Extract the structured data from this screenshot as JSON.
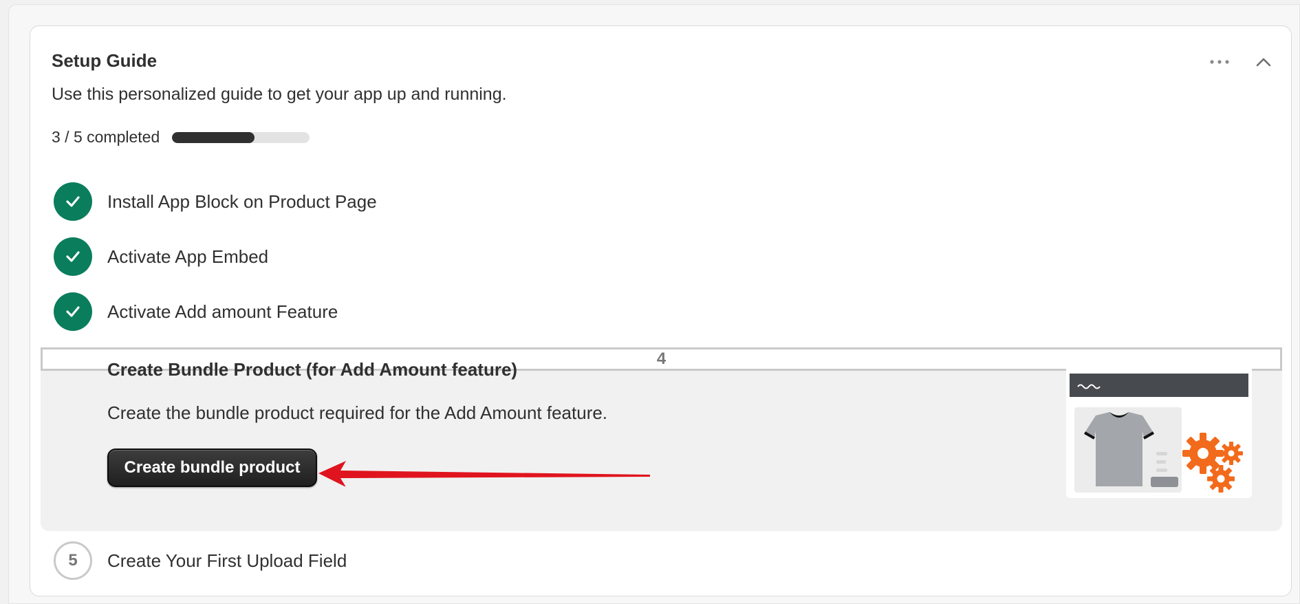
{
  "guide": {
    "title": "Setup Guide",
    "subtitle": "Use this personalized guide to get your app up and running.",
    "progress": {
      "text": "3 / 5 completed",
      "completed": 3,
      "total": 5,
      "fraction": 0.6
    },
    "actions": {
      "more_icon": "ellipsis-horizontal-icon",
      "collapse_icon": "chevron-up-icon"
    }
  },
  "steps": [
    {
      "number": "1",
      "label": "Install App Block on Product Page",
      "status": "completed"
    },
    {
      "number": "2",
      "label": "Activate App Embed",
      "status": "completed"
    },
    {
      "number": "3",
      "label": "Activate Add amount Feature",
      "status": "completed"
    },
    {
      "number": "4",
      "label": "Create Bundle Product (for Add Amount feature)",
      "status": "active",
      "description": "Create the bundle product required for the Add Amount feature.",
      "button_label": "Create bundle product"
    },
    {
      "number": "5",
      "label": "Create Your First Upload Field",
      "status": "pending"
    }
  ],
  "colors": {
    "completed": "#0a7d5c",
    "primary_button": "#303030",
    "annotation_arrow": "#e0141e",
    "illustration_gears": "#f26a1b"
  }
}
